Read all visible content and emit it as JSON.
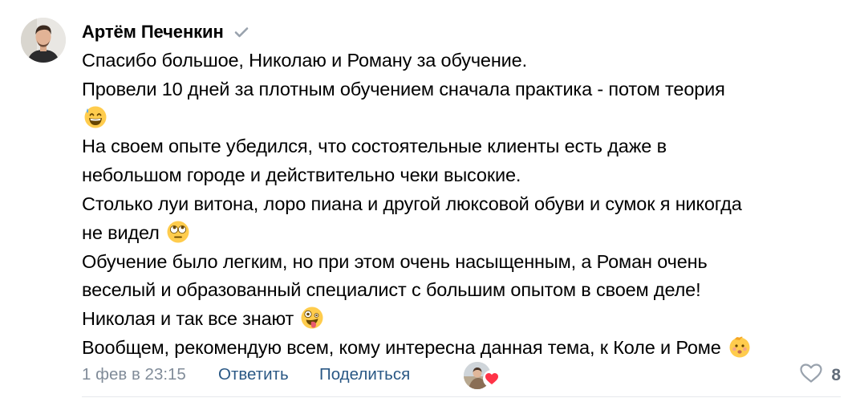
{
  "comment": {
    "author": "Артём Печенкин",
    "verified_icon": "checkmark-icon",
    "avatar_icon": "user-avatar",
    "lines": [
      {
        "text": "Спасибо большое, Николаю и Роману за обучение.",
        "emoji": ""
      },
      {
        "text": "Провели 10 дней за плотным обучением сначала практика - потом теория",
        "emoji": ""
      },
      {
        "text": "",
        "emoji": "grinning-sweat-emoji"
      },
      {
        "text": "На своем опыте убедился, что состоятельные клиенты есть даже в",
        "emoji": ""
      },
      {
        "text": "небольшом городе и действительно чеки высокие.",
        "emoji": ""
      },
      {
        "text": "Столько луи витона, лоро пиана и другой люксовой обуви и сумок я никогда",
        "emoji": ""
      },
      {
        "text": "не видел",
        "emoji": "eye-roll-emoji"
      },
      {
        "text": "Обучение было легким, но при этом очень насыщенным, а Роман очень",
        "emoji": ""
      },
      {
        "text": "веселый и образованный специалист с большим опытом в своем деле!",
        "emoji": ""
      },
      {
        "text": "Николая и так все знают",
        "emoji": "zany-face-emoji"
      },
      {
        "text": "Вообщем, рекомендую всем, кому интересна данная тема, к Коле и Роме",
        "emoji": "baby-face-emoji"
      }
    ]
  },
  "footer": {
    "date": "1 фев в 23:15",
    "reply_label": "Ответить",
    "share_label": "Поделиться",
    "reaction_icon": "heart-icon",
    "like_icon": "heart-outline-icon",
    "like_count": "8"
  },
  "colors": {
    "link": "#2a5885",
    "meta": "#818c99",
    "heart": "#ff3347",
    "verified": "#99a2ad",
    "emoji_yellow": "#ffcc4d"
  }
}
